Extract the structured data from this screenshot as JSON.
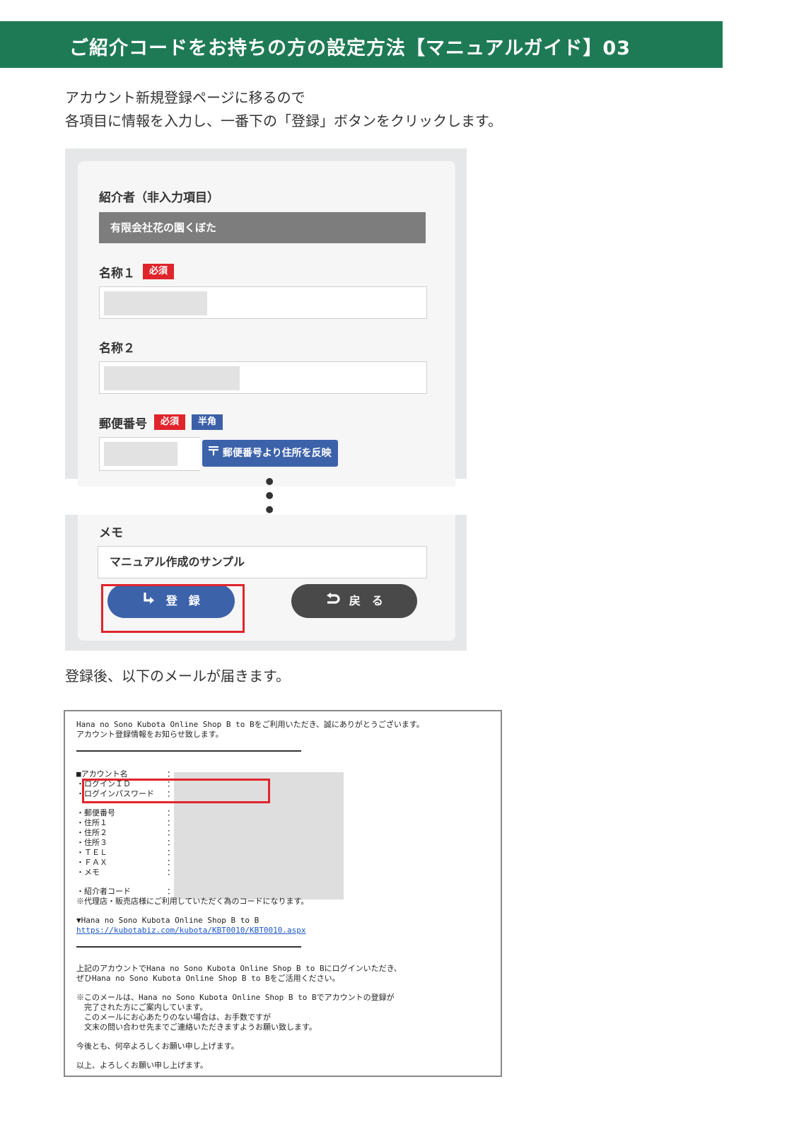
{
  "header": {
    "title": "ご紹介コードをお持ちの方の設定方法【マニュアルガイド】03"
  },
  "intro": {
    "line1": "アカウント新規登録ページに移るので",
    "line2": "各項目に情報を入力し、一番下の「登録」ボタンをクリックします。"
  },
  "form": {
    "referrer_label": "紹介者（非入力項目）",
    "referrer_value": "有限会社花の園くぼた",
    "name1_label": "名称１",
    "name2_label": "名称２",
    "postal_label": "郵便番号",
    "required_badge": "必須",
    "halfwidth_badge": "半角",
    "postal_button": "郵便番号より住所を反映",
    "ellipsis": "⋮",
    "memo_label": "メモ",
    "memo_value": "マニュアル作成のサンプル",
    "register_button": "登　録",
    "back_button": "戻　る"
  },
  "after_text": "登録後、以下のメールが届きます。",
  "mail": {
    "intro1": "Hana no Sono Kubota Online Shop B to Bをご利用いただき、誠にありがとうございます。",
    "intro2": "アカウント登録情報をお知らせ致します。",
    "account_name": "■アカウント名",
    "login_id": "・ログインＩＤ",
    "login_password": "・ログインパスワード",
    "postal": "・郵便番号",
    "address1": "・住所１",
    "address2": "・住所２",
    "address3": "・住所３",
    "tel": "・ＴＥＬ",
    "fax": "・ＦＡＸ",
    "memo": "・メモ",
    "referral_code": "・紹介者コード",
    "colon": "：",
    "note": "※代理店・販売店様にご利用していただく為のコードになります。",
    "shop_name": "▼Hana no Sono Kubota Online Shop B to B",
    "shop_url": "https://kubotabiz.com/kubota/KBT0010/KBT0010.aspx",
    "closing1": "上記のアカウントでHana no Sono Kubota Online Shop B to Bにログインいただき、",
    "closing2": "ぜひHana no Sono Kubota Online Shop B to Bをご活用ください。",
    "notice1": "※このメールは、Hana no Sono Kubota Online Shop B to Bでアカウントの登録が",
    "notice2": "　完了された方にご案内しています。",
    "notice3": "　このメールにお心あたりのない場合は、お手数ですが",
    "notice4": "　文末の問い合わせ先までご連絡いただきますようお願い致します。",
    "regards1": "今後とも、何卒よろしくお願い申し上げます。",
    "regards2": "以上、よろしくお願い申し上げます。"
  }
}
